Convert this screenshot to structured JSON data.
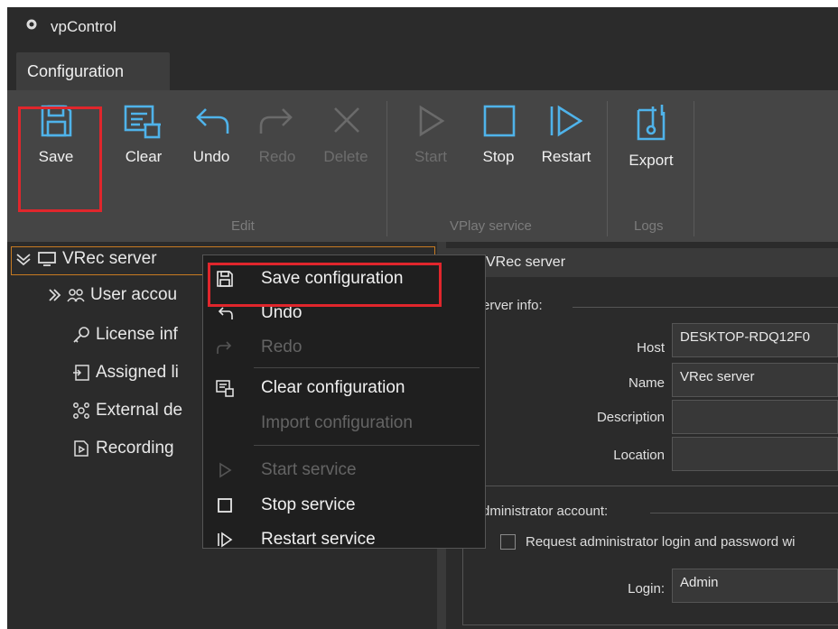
{
  "app": {
    "title": "vpControl"
  },
  "tabs": [
    {
      "label": "Configuration"
    }
  ],
  "ribbon": {
    "buttons": {
      "save": "Save",
      "clear": "Clear",
      "undo": "Undo",
      "redo": "Redo",
      "delete": "Delete",
      "start": "Start",
      "stop": "Stop",
      "restart": "Restart",
      "export": "Export"
    },
    "groups": {
      "edit": "Edit",
      "vplay": "VPlay service",
      "logs": "Logs"
    }
  },
  "tree": {
    "root": "VRec server",
    "items": [
      "User accou",
      "License inf",
      "Assigned li",
      "External de",
      "Recording"
    ]
  },
  "context_menu": {
    "items": [
      {
        "label": "Save configuration",
        "disabled": false
      },
      {
        "label": "Undo",
        "disabled": false
      },
      {
        "label": "Redo",
        "disabled": true
      },
      {
        "label": "Clear configuration",
        "disabled": false
      },
      {
        "label": "Import configuration",
        "disabled": true
      },
      {
        "label": "Start service",
        "disabled": true
      },
      {
        "label": "Stop service",
        "disabled": false
      },
      {
        "label": "Restart service",
        "disabled": false
      }
    ]
  },
  "details": {
    "header": "VRec server",
    "server_info": {
      "title": "erver info:",
      "host_label": "Host",
      "host_value": "DESKTOP-RDQ12F0",
      "name_label": "Name",
      "name_value": "VRec server",
      "description_label": "Description",
      "description_value": "",
      "location_label": "Location",
      "location_value": ""
    },
    "admin": {
      "title": "dministrator account:",
      "request_label": "Request administrator login and password wi",
      "login_label": "Login:",
      "login_value": "Admin"
    }
  },
  "colors": {
    "highlight": "#e0262c",
    "ribbon_bg": "#454545",
    "app_bg": "#2b2b2b",
    "menu_bg": "#1f1f1f"
  }
}
